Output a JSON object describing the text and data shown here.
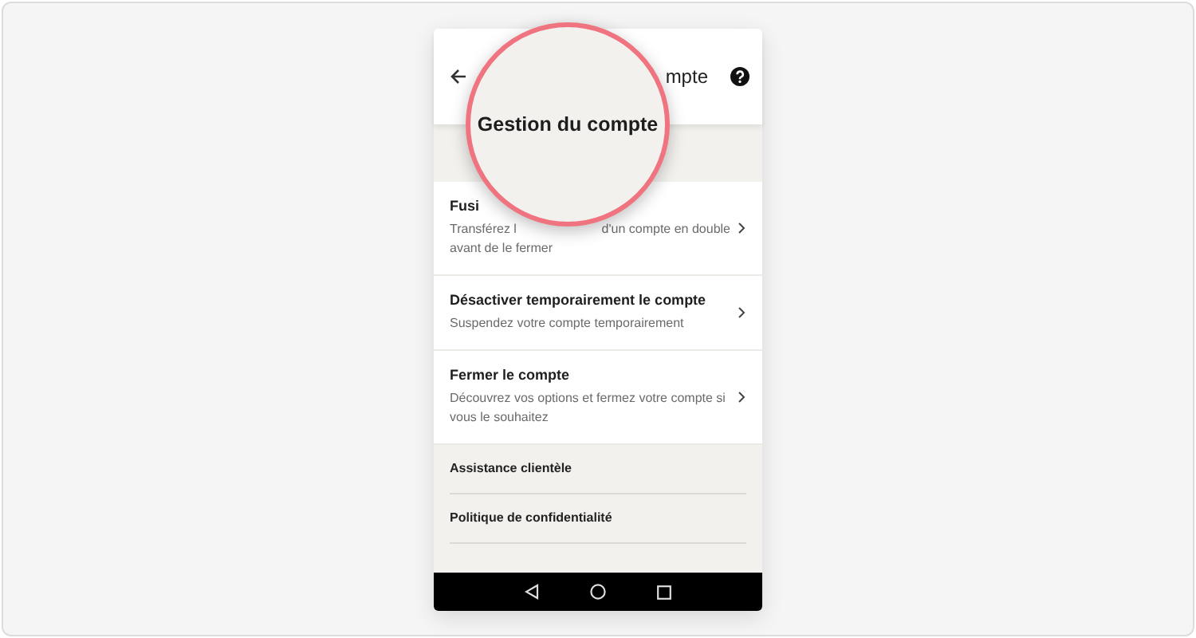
{
  "header": {
    "title": "mpte"
  },
  "magnifier": {
    "text": "Gestion du compte"
  },
  "items": [
    {
      "title": "Fusi",
      "description_lines": [
        [
          "Transférez l",
          "d'un compte en double"
        ],
        [
          "avant de le fermer"
        ]
      ]
    },
    {
      "title": "Désactiver temporairement le compte",
      "description_lines": [
        [
          "Suspendez votre compte temporairement"
        ]
      ]
    },
    {
      "title": "Fermer le compte",
      "description_lines": [
        [
          "Découvrez vos options et fermez votre compte si"
        ],
        [
          "vous le souhaitez"
        ]
      ]
    }
  ],
  "footer_links": [
    "Assistance clientèle",
    "Politique de confidentialité"
  ]
}
